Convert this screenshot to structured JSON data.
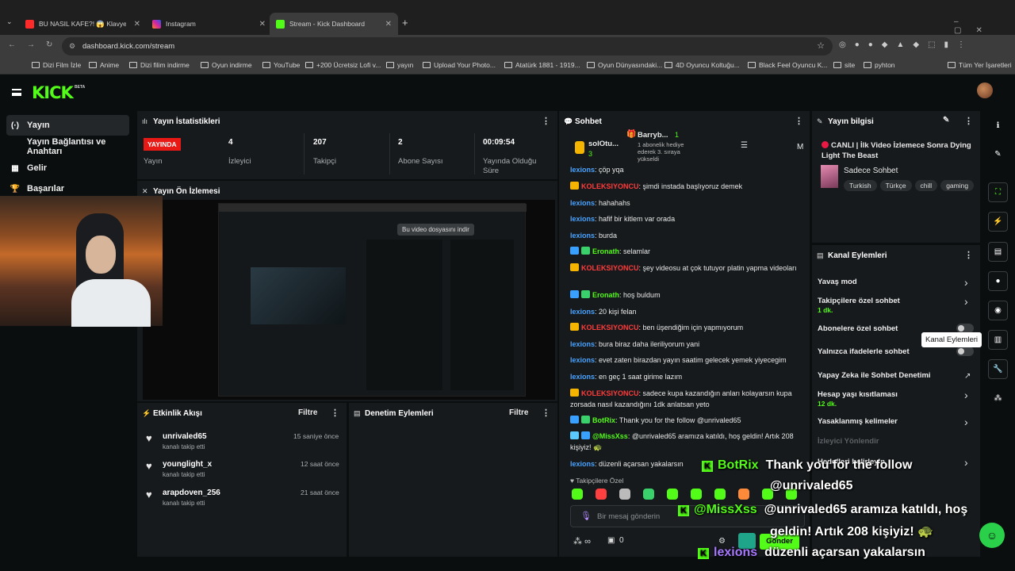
{
  "browser": {
    "tabs": [
      {
        "label": "BU NASIL KAFE?! 😱 Klavyeler",
        "color": "#ff2a2a"
      },
      {
        "label": "Instagram",
        "color": "#d6249f"
      },
      {
        "label": "Stream - Kick Dashboard",
        "color": "#53fc18"
      }
    ],
    "new_tab": "+",
    "url": "dashboard.kick.com/stream",
    "bookmarks": [
      "Dizi Film İzle",
      "Anime",
      "Dizi filim indirme",
      "Oyun indirme",
      "YouTube",
      "+200 Ücretsiz Lofi v...",
      "yayın",
      "Upload Your Photo...",
      "Atatürk 1881 - 1919...",
      "Oyun Dünyasındaki...",
      "4D Oyuncu Koltuğu...",
      "Black Feel Oyuncu K...",
      "site",
      "pyhton"
    ],
    "all_bookmarks": "Tüm Yer İşaretleri"
  },
  "header": {
    "logo": "KICK",
    "beta": "BETA"
  },
  "nav": [
    {
      "icon": "(·)",
      "label": "Yayın"
    },
    {
      "icon": "",
      "label": "Yayın Bağlantısı ve Anahtarı"
    },
    {
      "icon": "▦",
      "label": "Gelir"
    },
    {
      "icon": "🏆",
      "label": "Başarılar"
    }
  ],
  "stats": {
    "title": "Yayın İstatistikleri",
    "live": "YAYINDA",
    "live_label": "Yayın",
    "items": [
      {
        "value": "4",
        "label": "İzleyici"
      },
      {
        "value": "207",
        "label": "Takipçi"
      },
      {
        "value": "2",
        "label": "Abone Sayısı"
      },
      {
        "value": "00:09:54",
        "label": "Yayında Olduğu Süre"
      }
    ]
  },
  "preview": {
    "title": "Yayın Ön İzlemesi",
    "download": "Bu video dosyasını indir"
  },
  "feed": {
    "title": "Etkinlik Akışı",
    "filter": "Filtre",
    "items": [
      {
        "name": "unrivaled65",
        "sub": "kanalı takip etti",
        "time": "15 saniye önce"
      },
      {
        "name": "younglight_x",
        "sub": "kanalı takip etti",
        "time": "12 saat önce"
      },
      {
        "name": "arapdoven_256",
        "sub": "kanalı takip etti",
        "time": "21 saat önce"
      }
    ]
  },
  "moderation": {
    "title": "Denetim Eylemleri",
    "filter": "Filtre"
  },
  "chat": {
    "title": "Sohbet",
    "top_gifter": "solOtu...",
    "top_gifter_count": "3",
    "pinned_user": "Barryb...",
    "pinned_count": "1",
    "pinned_sub": "1 abonelik hediye ederek 3. sıraya yükseldi",
    "messages": [
      {
        "user": "lexions",
        "color": "#4aa3ff",
        "text": "çöp yqa",
        "badges": []
      },
      {
        "user": "KOLEKSIYONCU",
        "color": "#ff3b3b",
        "text": "şimdi instada başlıyoruz demek",
        "badges": [
          "#f5b400"
        ]
      },
      {
        "user": "lexions",
        "color": "#4aa3ff",
        "text": "hahahahs",
        "badges": []
      },
      {
        "user": "lexions",
        "color": "#4aa3ff",
        "text": "hafif bir kitlem var orada",
        "badges": []
      },
      {
        "user": "lexions",
        "color": "#4aa3ff",
        "text": "burda",
        "badges": []
      },
      {
        "user": "Eronath",
        "color": "#53fc18",
        "text": "selamlar",
        "badges": [
          "#3aa0ff",
          "#3ad06b"
        ]
      },
      {
        "user": "KOLEKSIYONCU",
        "color": "#ff3b3b",
        "text": "şey videosu at çok tutuyor platin yapma videoları",
        "badges": [
          "#f5b400"
        ]
      },
      {
        "user": "Eronath",
        "color": "#53fc18",
        "text": "hoş buldum",
        "badges": [
          "#3aa0ff",
          "#3ad06b"
        ]
      },
      {
        "user": "lexions",
        "color": "#4aa3ff",
        "text": "20 kişi felan",
        "badges": []
      },
      {
        "user": "KOLEKSIYONCU",
        "color": "#ff3b3b",
        "text": "ben üşendiğim için yapmıyorum",
        "badges": [
          "#f5b400"
        ]
      },
      {
        "user": "lexions",
        "color": "#4aa3ff",
        "text": "bura biraz daha ileriliyorum yani",
        "badges": []
      },
      {
        "user": "lexions",
        "color": "#4aa3ff",
        "text": "evet zaten birazdan yayın saatim gelecek yemek yiyecegim",
        "badges": []
      },
      {
        "user": "lexions",
        "color": "#4aa3ff",
        "text": "en geç 1 saat girime lazım",
        "badges": []
      },
      {
        "user": "KOLEKSIYONCU",
        "color": "#ff3b3b",
        "text": "sadece kupa kazandığın anları kolayarsın kupa zorsada nasıl kazandığını 1dk anlatsan yeto",
        "badges": [
          "#f5b400"
        ]
      },
      {
        "user": "BotRix",
        "color": "#53fc18",
        "text": "Thank you for the follow @unrivaled65",
        "badges": [
          "#3aa0ff",
          "#3ad06b"
        ]
      },
      {
        "user": "@MissXss",
        "color": "#53fc18",
        "text": "@unrivaled65 aramıza katıldı, hoş geldin! Artık 208 kişiyiz! 🐢",
        "badges": [
          "#5ac8fa",
          "#3aa0ff"
        ]
      },
      {
        "user": "lexions",
        "color": "#4aa3ff",
        "text": "düzenli açarsan yakalarsın",
        "badges": []
      }
    ],
    "followers_only": "Takipçilere Özel",
    "placeholder": "Bir mesaj gönderin",
    "send": "Gönder",
    "footer_count": "0",
    "footer_infinity": "∞"
  },
  "info": {
    "title": "Yayın bilgisi",
    "stream_title": "CANLI | İlk Video İzlemece Sonra Dying Light The Beast",
    "category": "Sadece Sohbet",
    "tags": [
      "Turkish",
      "Türkçe",
      "chill",
      "gaming"
    ]
  },
  "actions": {
    "title": "Kanal Eylemleri",
    "tooltip": "Kanal Eylemleri",
    "rows": [
      {
        "label": "Yavaş mod",
        "sub": "",
        "type": "chevron"
      },
      {
        "label": "Takipçilere özel sohbet",
        "sub": "1 dk.",
        "type": "chevron"
      },
      {
        "label": "Abonelere özel sohbet",
        "sub": "",
        "type": "toggle"
      },
      {
        "label": "Yalnızca ifadelerle sohbet",
        "sub": "",
        "type": "toggle"
      },
      {
        "label": "Yapay Zeka ile Sohbet Denetimi",
        "sub": "",
        "type": "external"
      },
      {
        "label": "Hesap yaşı kısıtlaması",
        "sub": "12 dk.",
        "type": "chevron"
      },
      {
        "label": "Yasaklanmış kelimeler",
        "sub": "",
        "type": "chevron"
      },
      {
        "label": "İzleyici Yönlendir",
        "sub": "",
        "type": "none"
      },
      {
        "label": "Hedefleri belirleyin",
        "sub": "",
        "type": "chevron"
      }
    ]
  },
  "overlay": [
    {
      "user": "BotRix",
      "text": "Thank you for the follow"
    },
    {
      "user": "",
      "text": "@unrivaled65"
    },
    {
      "user": "@MissXss",
      "text": "@unrivaled65 aramıza katıldı, hoş"
    },
    {
      "user": "",
      "text": "geldin! Artık 208 kişiyiz! 🐢"
    },
    {
      "user": "lexions",
      "text": "düzenli açarsan yakalarsın"
    }
  ],
  "colors": {
    "accent": "#53fc18",
    "live": "#e91916",
    "panel": "#161a1c",
    "bg": "#0b0e0f"
  }
}
